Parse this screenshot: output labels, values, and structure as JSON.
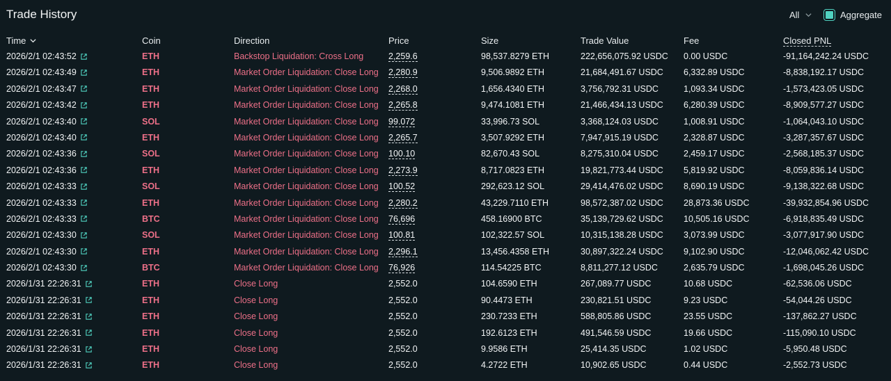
{
  "header": {
    "title": "Trade History",
    "filter_label": "All",
    "aggregate_label": "Aggregate"
  },
  "columns": [
    "Time",
    "Coin",
    "Direction",
    "Price",
    "Size",
    "Trade Value",
    "Fee",
    "Closed PNL"
  ],
  "rows": [
    {
      "time": "2026/2/1 02:43:52",
      "coin": "ETH",
      "direction": "Backstop Liquidation: Cross Long",
      "price": "2,259.6",
      "size": "98,537.8279 ETH",
      "value": "222,656,075.92 USDC",
      "fee": "0.00 USDC",
      "pnl": "-91,164,242.24 USDC",
      "dashed": true
    },
    {
      "time": "2026/2/1 02:43:49",
      "coin": "ETH",
      "direction": "Market Order Liquidation: Close Long",
      "price": "2,280.9",
      "size": "9,506.9892 ETH",
      "value": "21,684,491.67 USDC",
      "fee": "6,332.89 USDC",
      "pnl": "-8,838,192.17 USDC",
      "dashed": true
    },
    {
      "time": "2026/2/1 02:43:47",
      "coin": "ETH",
      "direction": "Market Order Liquidation: Close Long",
      "price": "2,268.0",
      "size": "1,656.4340 ETH",
      "value": "3,756,792.31 USDC",
      "fee": "1,093.34 USDC",
      "pnl": "-1,573,423.05 USDC",
      "dashed": true
    },
    {
      "time": "2026/2/1 02:43:42",
      "coin": "ETH",
      "direction": "Market Order Liquidation: Close Long",
      "price": "2,265.8",
      "size": "9,474.1081 ETH",
      "value": "21,466,434.13 USDC",
      "fee": "6,280.39 USDC",
      "pnl": "-8,909,577.27 USDC",
      "dashed": true
    },
    {
      "time": "2026/2/1 02:43:40",
      "coin": "SOL",
      "direction": "Market Order Liquidation: Close Long",
      "price": "99.072",
      "size": "33,996.73 SOL",
      "value": "3,368,124.03 USDC",
      "fee": "1,008.91 USDC",
      "pnl": "-1,064,043.10 USDC",
      "dashed": true
    },
    {
      "time": "2026/2/1 02:43:40",
      "coin": "ETH",
      "direction": "Market Order Liquidation: Close Long",
      "price": "2,265.7",
      "size": "3,507.9292 ETH",
      "value": "7,947,915.19 USDC",
      "fee": "2,328.87 USDC",
      "pnl": "-3,287,357.67 USDC",
      "dashed": true
    },
    {
      "time": "2026/2/1 02:43:36",
      "coin": "SOL",
      "direction": "Market Order Liquidation: Close Long",
      "price": "100.10",
      "size": "82,670.43 SOL",
      "value": "8,275,310.04 USDC",
      "fee": "2,459.17 USDC",
      "pnl": "-2,568,185.37 USDC",
      "dashed": true
    },
    {
      "time": "2026/2/1 02:43:36",
      "coin": "ETH",
      "direction": "Market Order Liquidation: Close Long",
      "price": "2,273.9",
      "size": "8,717.0823 ETH",
      "value": "19,821,773.44 USDC",
      "fee": "5,819.92 USDC",
      "pnl": "-8,059,836.14 USDC",
      "dashed": true
    },
    {
      "time": "2026/2/1 02:43:33",
      "coin": "SOL",
      "direction": "Market Order Liquidation: Close Long",
      "price": "100.52",
      "size": "292,623.12 SOL",
      "value": "29,414,476.02 USDC",
      "fee": "8,690.19 USDC",
      "pnl": "-9,138,322.68 USDC",
      "dashed": true
    },
    {
      "time": "2026/2/1 02:43:33",
      "coin": "ETH",
      "direction": "Market Order Liquidation: Close Long",
      "price": "2,280.2",
      "size": "43,229.7110 ETH",
      "value": "98,572,387.02 USDC",
      "fee": "28,873.36 USDC",
      "pnl": "-39,932,854.96 USDC",
      "dashed": true
    },
    {
      "time": "2026/2/1 02:43:33",
      "coin": "BTC",
      "direction": "Market Order Liquidation: Close Long",
      "price": "76,696",
      "size": "458.16900 BTC",
      "value": "35,139,729.62 USDC",
      "fee": "10,505.16 USDC",
      "pnl": "-6,918,835.49 USDC",
      "dashed": true
    },
    {
      "time": "2026/2/1 02:43:30",
      "coin": "SOL",
      "direction": "Market Order Liquidation: Close Long",
      "price": "100.81",
      "size": "102,322.57 SOL",
      "value": "10,315,138.28 USDC",
      "fee": "3,073.99 USDC",
      "pnl": "-3,077,917.90 USDC",
      "dashed": true
    },
    {
      "time": "2026/2/1 02:43:30",
      "coin": "ETH",
      "direction": "Market Order Liquidation: Close Long",
      "price": "2,296.1",
      "size": "13,456.4358 ETH",
      "value": "30,897,322.24 USDC",
      "fee": "9,102.90 USDC",
      "pnl": "-12,046,062.42 USDC",
      "dashed": true
    },
    {
      "time": "2026/2/1 02:43:30",
      "coin": "BTC",
      "direction": "Market Order Liquidation: Close Long",
      "price": "76,926",
      "size": "114.54225 BTC",
      "value": "8,811,277.12 USDC",
      "fee": "2,635.79 USDC",
      "pnl": "-1,698,045.26 USDC",
      "dashed": true
    },
    {
      "time": "2026/1/31 22:26:31",
      "coin": "ETH",
      "direction": "Close Long",
      "price": "2,552.0",
      "size": "104.6590 ETH",
      "value": "267,089.77 USDC",
      "fee": "10.68 USDC",
      "pnl": "-62,536.06 USDC",
      "dashed": false
    },
    {
      "time": "2026/1/31 22:26:31",
      "coin": "ETH",
      "direction": "Close Long",
      "price": "2,552.0",
      "size": "90.4473 ETH",
      "value": "230,821.51 USDC",
      "fee": "9.23 USDC",
      "pnl": "-54,044.26 USDC",
      "dashed": false
    },
    {
      "time": "2026/1/31 22:26:31",
      "coin": "ETH",
      "direction": "Close Long",
      "price": "2,552.0",
      "size": "230.7233 ETH",
      "value": "588,805.86 USDC",
      "fee": "23.55 USDC",
      "pnl": "-137,862.27 USDC",
      "dashed": false
    },
    {
      "time": "2026/1/31 22:26:31",
      "coin": "ETH",
      "direction": "Close Long",
      "price": "2,552.0",
      "size": "192.6123 ETH",
      "value": "491,546.59 USDC",
      "fee": "19.66 USDC",
      "pnl": "-115,090.10 USDC",
      "dashed": false
    },
    {
      "time": "2026/1/31 22:26:31",
      "coin": "ETH",
      "direction": "Close Long",
      "price": "2,552.0",
      "size": "9.9586 ETH",
      "value": "25,414.35 USDC",
      "fee": "1.02 USDC",
      "pnl": "-5,950.48 USDC",
      "dashed": false
    },
    {
      "time": "2026/1/31 22:26:31",
      "coin": "ETH",
      "direction": "Close Long",
      "price": "2,552.0",
      "size": "4.2722 ETH",
      "value": "10,902.65 USDC",
      "fee": "0.44 USDC",
      "pnl": "-2,552.73 USDC",
      "dashed": false
    }
  ]
}
